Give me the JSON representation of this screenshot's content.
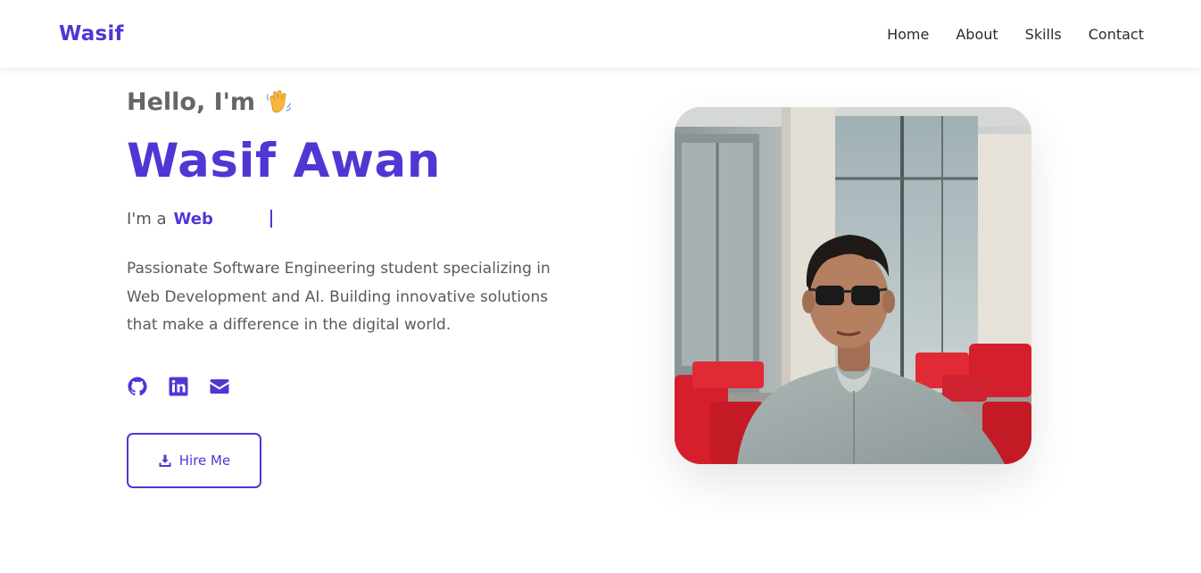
{
  "nav": {
    "logo": "Wasif",
    "links": [
      "Home",
      "About",
      "Skills",
      "Contact"
    ]
  },
  "hero": {
    "greeting": "Hello, I'm",
    "greeting_icon": "waving-hand-icon",
    "name": "Wasif Awan",
    "role_prefix": "I'm a",
    "role_word": "Web",
    "description": "Passionate Software Engineering student specializing in Web Development and AI. Building innovative solutions that make a difference in the digital world.",
    "socials": [
      "github-icon",
      "linkedin-icon",
      "email-icon"
    ],
    "hire_label": "Hire Me",
    "hire_icon": "download-icon"
  },
  "colors": {
    "accent": "#4f37d4",
    "text_muted": "#666666"
  }
}
